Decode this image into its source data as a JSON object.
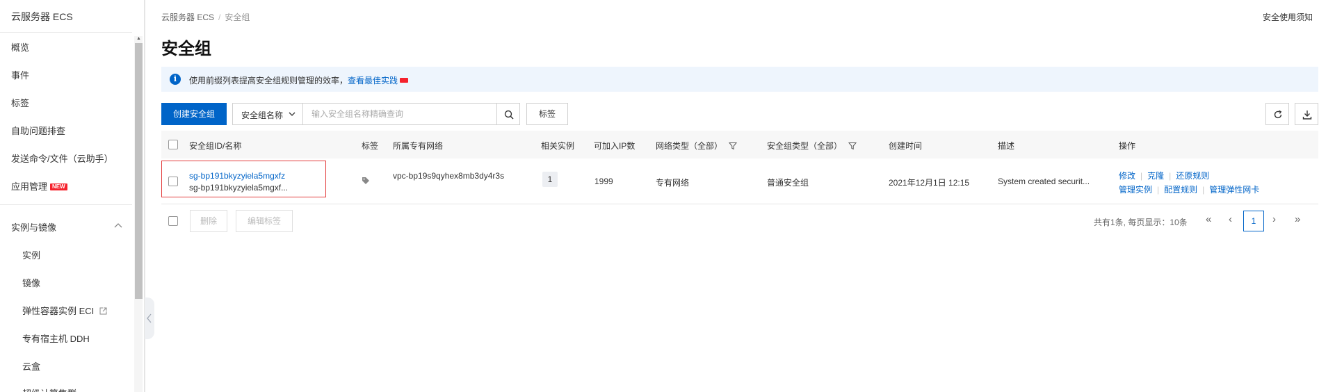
{
  "sidebar": {
    "title": "云服务器 ECS",
    "items": [
      {
        "label": "概览"
      },
      {
        "label": "事件"
      },
      {
        "label": "标签"
      },
      {
        "label": "自助问题排查"
      },
      {
        "label": "发送命令/文件（云助手）"
      },
      {
        "label": "应用管理",
        "badge": "NEW"
      }
    ],
    "group": {
      "label": "实例与镜像"
    },
    "sub_items": [
      {
        "label": "实例"
      },
      {
        "label": "镜像"
      },
      {
        "label": "弹性容器实例 ECI"
      },
      {
        "label": "专有宿主机 DDH"
      },
      {
        "label": "云盒"
      },
      {
        "label": "超级计算集群"
      }
    ]
  },
  "breadcrumb": {
    "root": "云服务器 ECS",
    "separator": "/",
    "current": "安全组"
  },
  "top_link": "安全使用须知",
  "page_title": "安全组",
  "info": {
    "text": "使用前缀列表提高安全组规则管理的效率，",
    "link": "查看最佳实践"
  },
  "toolbar": {
    "create_label": "创建安全组",
    "select_value": "安全组名称",
    "search_placeholder": "输入安全组名称精确查询",
    "tag_label": "标签"
  },
  "table": {
    "headers": {
      "id_name": "安全组ID/名称",
      "tag": "标签",
      "vpc": "所属专有网络",
      "instances": "相关实例",
      "ip_count": "可加入IP数",
      "network_type": "网络类型（全部）",
      "group_type": "安全组类型（全部）",
      "created": "创建时间",
      "description": "描述",
      "actions": "操作"
    },
    "rows": [
      {
        "id": "sg-bp191bkyzyiela5mgxfz",
        "name": "sg-bp191bkyzyiela5mgxf...",
        "vpc": "vpc-bp19s9qyhex8mb3dy4r3s",
        "instances": "1",
        "ip_count": "1999",
        "network_type": "专有网络",
        "group_type": "普通安全组",
        "created": "2021年12月1日 12:15",
        "description": "System created securit...",
        "actions": {
          "modify": "修改",
          "clone": "克隆",
          "restore": "还原规则",
          "manage_instances": "管理实例",
          "configure_rules": "配置规则",
          "manage_eni": "管理弹性网卡"
        }
      }
    ]
  },
  "footer": {
    "delete_label": "删除",
    "edit_tags_label": "编辑标签",
    "summary": "共有1条, 每页显示：10条",
    "first": "«",
    "prev": "‹",
    "current_page": "1",
    "next": "›",
    "last": "»"
  },
  "colors": {
    "primary": "#0064c8",
    "highlight": "#e23a3a",
    "new_badge": "#f5222d"
  }
}
